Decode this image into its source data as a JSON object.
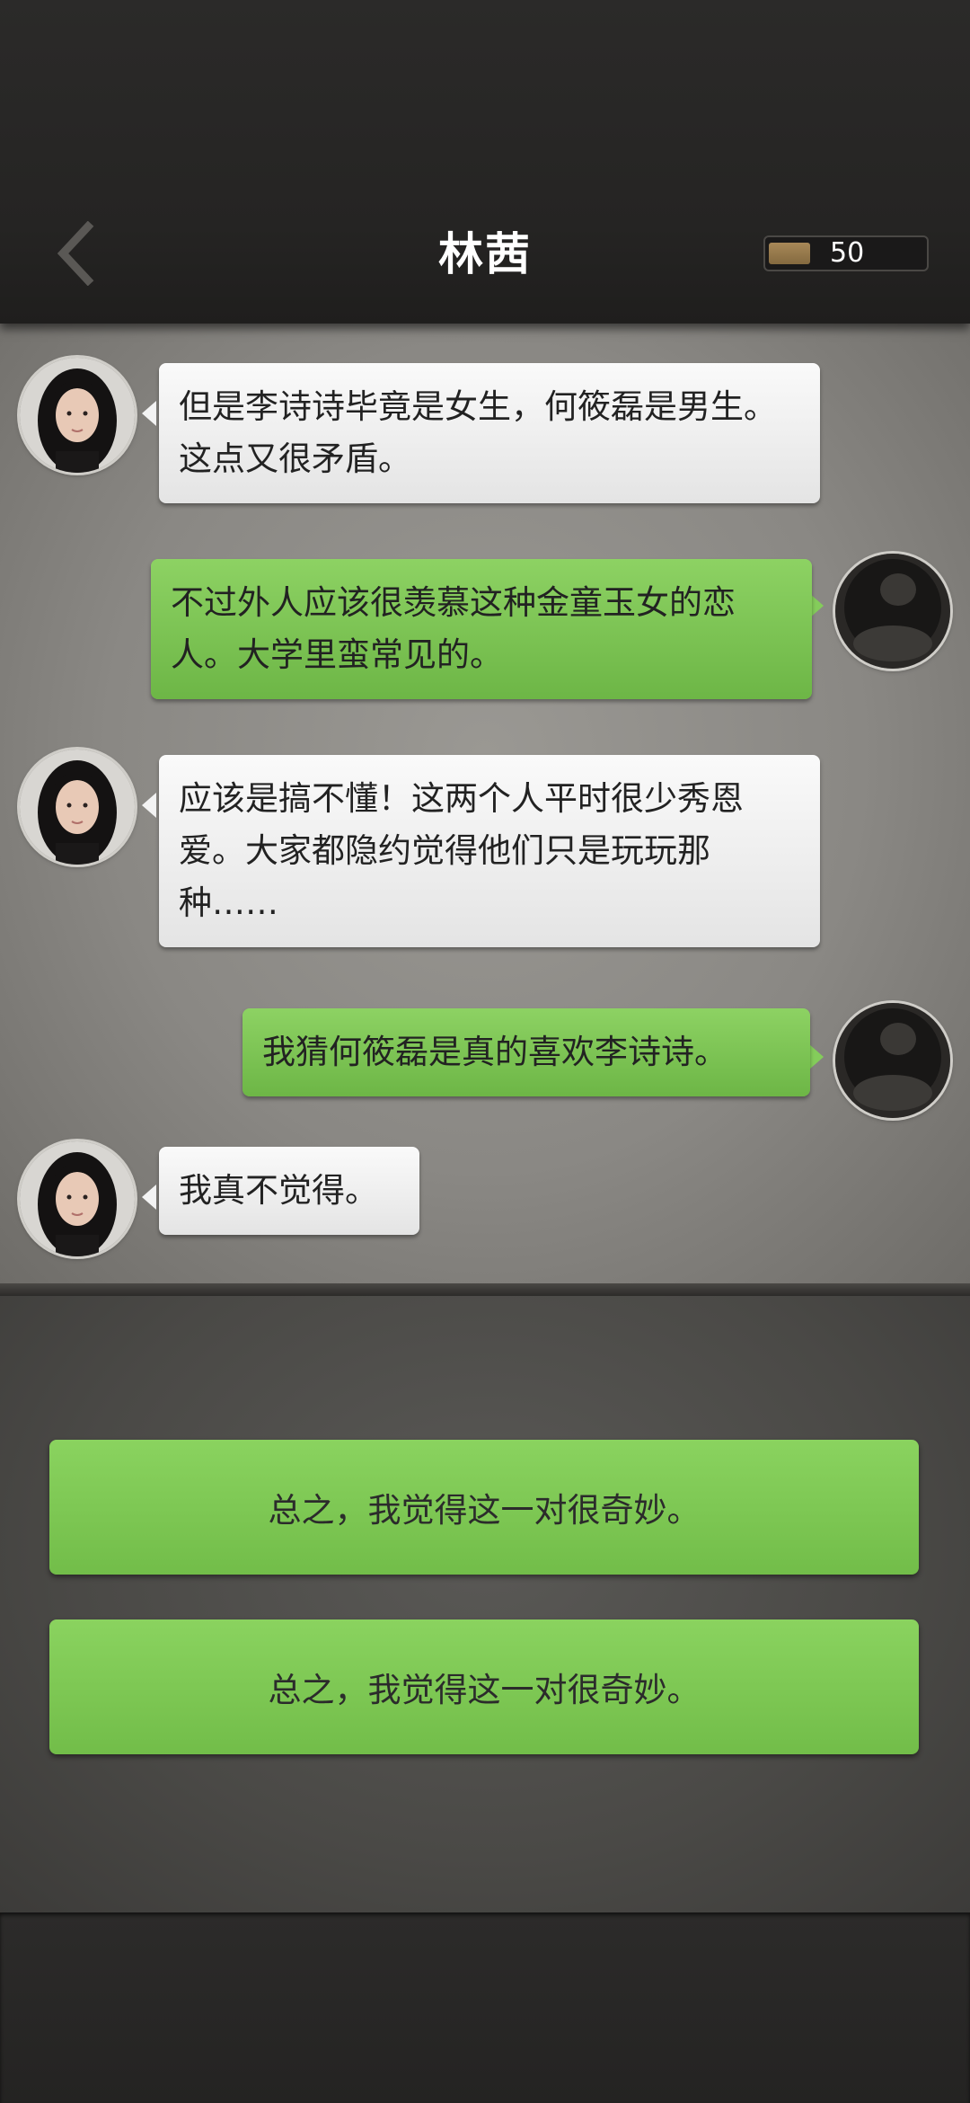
{
  "header": {
    "title": "林茜",
    "coins": "50"
  },
  "messages": [
    {
      "side": "left",
      "sender": "林茜",
      "text": "但是李诗诗毕竟是女生，何筱磊是男生。这点又很矛盾。"
    },
    {
      "side": "right",
      "sender": "me",
      "text": "不过外人应该很羡慕这种金童玉女的恋人。大学里蛮常见的。"
    },
    {
      "side": "left",
      "sender": "林茜",
      "text": "应该是搞不懂！这两个人平时很少秀恩爱。大家都隐约觉得他们只是玩玩那种……"
    },
    {
      "side": "right",
      "sender": "me",
      "text": "我猜何筱磊是真的喜欢李诗诗。"
    },
    {
      "side": "left",
      "sender": "林茜",
      "text": "我真不觉得。"
    }
  ],
  "choices": [
    {
      "label": "总之，我觉得这一对很奇妙。"
    },
    {
      "label": "总之，我觉得这一对很奇妙。"
    }
  ],
  "colors": {
    "bubble_left": "#f3f3f3",
    "bubble_right": "#7dc554",
    "choice": "#7dc554"
  }
}
